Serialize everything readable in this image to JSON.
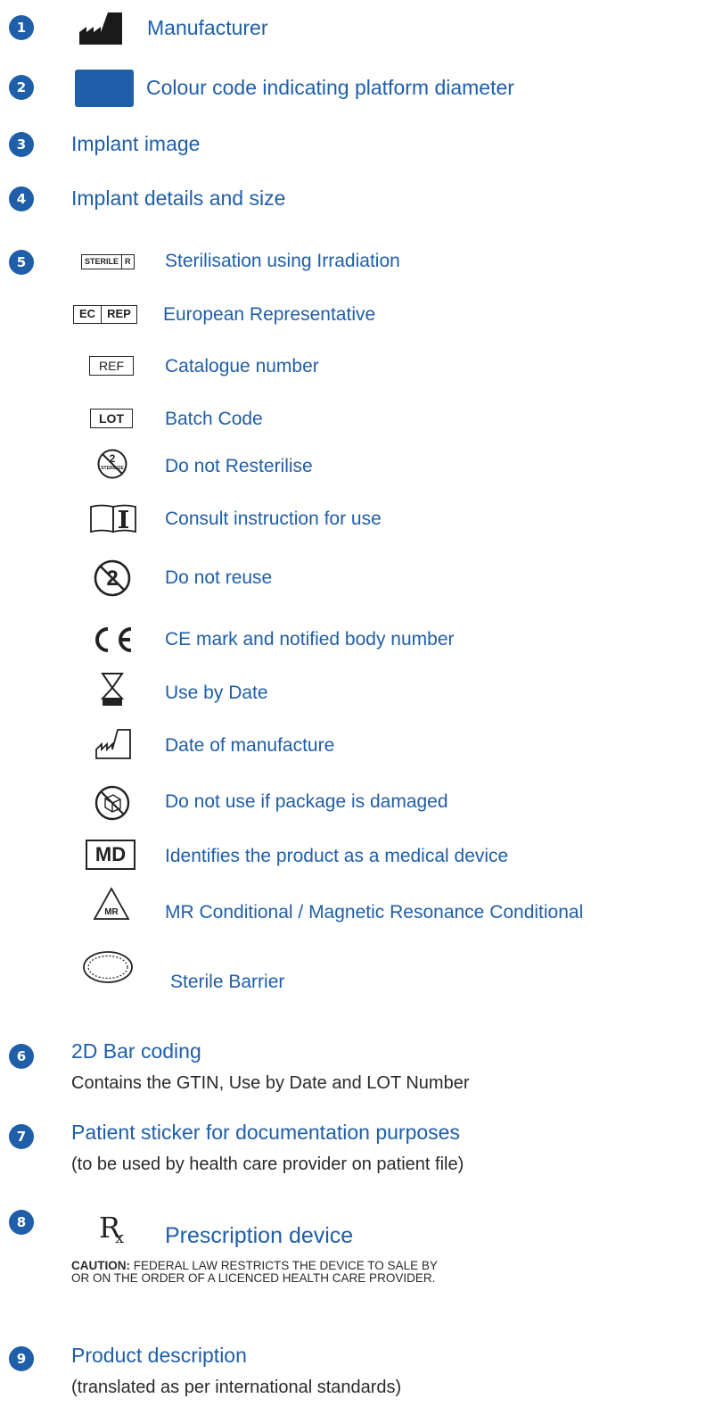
{
  "colors": {
    "accent": "#1f5ea8",
    "text": "#2a2a2a"
  },
  "items": [
    {
      "number": "1",
      "label": "Manufacturer",
      "icon": "manufacturer-icon"
    },
    {
      "number": "2",
      "label": "Colour code indicating platform diameter",
      "icon": "colour-code-swatch"
    },
    {
      "number": "3",
      "label": "Implant image"
    },
    {
      "number": "4",
      "label": "Implant details and size"
    },
    {
      "number": "5",
      "label": "Sterilisation using Irradiation",
      "icon_text": [
        "STERILE",
        "R"
      ]
    },
    {
      "number": "6",
      "label": "2D Bar coding",
      "sublabel": "Contains the GTIN, Use by Date and LOT Number"
    },
    {
      "number": "7",
      "label": "Patient sticker for documentation purposes",
      "sublabel": "(to be used by health care provider on patient file)"
    },
    {
      "number": "8",
      "label": "Prescription device",
      "caution_title": "CAUTION:",
      "caution_line1": " FEDERAL LAW RESTRICTS THE DEVICE TO SALE BY",
      "caution_line2": "OR ON THE ORDER OF A LICENCED HEALTH CARE PROVIDER."
    },
    {
      "number": "9",
      "label": "Product description",
      "sublabel": "(translated as per international standards)"
    }
  ],
  "symbols": [
    {
      "label": "European Representative",
      "icon_text": [
        "EC",
        "REP"
      ]
    },
    {
      "label": "Catalogue number",
      "icon_text": "REF"
    },
    {
      "label": "Batch Code",
      "icon_text": "LOT"
    },
    {
      "label": "Do not Resterilise",
      "icon_text": [
        "2",
        "STERILIZE"
      ]
    },
    {
      "label": "Consult instruction for use"
    },
    {
      "label": "Do not reuse",
      "icon_text": "2"
    },
    {
      "label": "CE mark and notified body number"
    },
    {
      "label": "Use by Date"
    },
    {
      "label": "Date of manufacture"
    },
    {
      "label": "Do not use if package is damaged"
    },
    {
      "label": "Identifies the product as a medical device",
      "icon_text": "MD"
    },
    {
      "label": "MR Conditional / Magnetic Resonance Conditional",
      "icon_text": "MR"
    },
    {
      "label": "Sterile Barrier"
    }
  ]
}
